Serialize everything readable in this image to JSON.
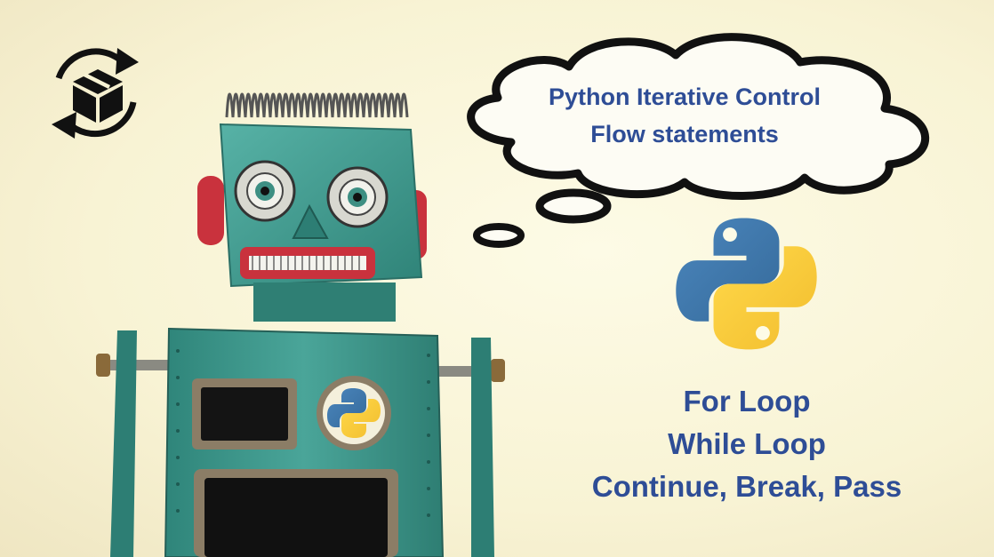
{
  "bubble": {
    "line1": "Python Iterative Control",
    "line2": "Flow statements"
  },
  "loops": {
    "items": [
      "For Loop",
      "While Loop",
      "Continue, Break, Pass"
    ]
  },
  "icons": {
    "top_left": "package-cycle-icon",
    "python_logo": "python-logo-icon",
    "robot": "robot-illustration"
  },
  "colors": {
    "text_blue": "#2e4d96",
    "python_blue": "#3d74a8",
    "python_yellow": "#f6c93b",
    "robot_teal": "#3c9c90"
  }
}
